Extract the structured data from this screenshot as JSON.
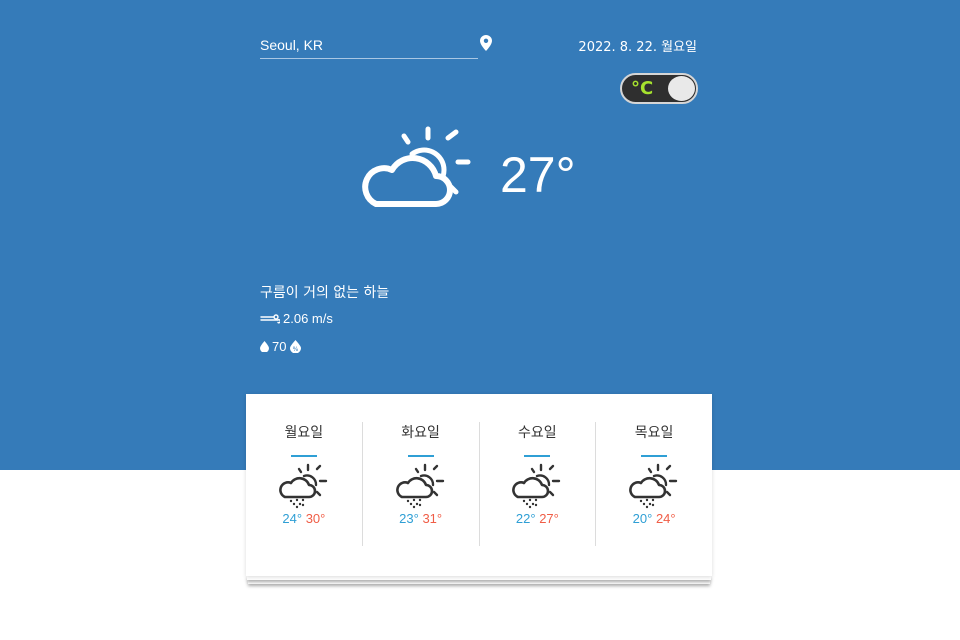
{
  "location": {
    "value": "Seoul, KR",
    "icon": "location-pin-icon"
  },
  "date": "2022. 8. 22. 월요일",
  "unit_toggle": {
    "label": "°C"
  },
  "current": {
    "temp": "27°",
    "icon": "partly-cloudy-icon",
    "description": "구름이 거의 없는 하늘",
    "wind": "2.06 m/s",
    "humidity": "70"
  },
  "forecast": [
    {
      "day": "월요일",
      "min": "24°",
      "max": "30°",
      "icon": "rain-sun-icon"
    },
    {
      "day": "화요일",
      "min": "23°",
      "max": "31°",
      "icon": "rain-sun-icon"
    },
    {
      "day": "수요일",
      "min": "22°",
      "max": "27°",
      "icon": "rain-sun-icon"
    },
    {
      "day": "목요일",
      "min": "20°",
      "max": "24°",
      "icon": "rain-sun-icon"
    }
  ],
  "colors": {
    "hero": "#357bb9",
    "min_temp": "#2f9fd5",
    "max_temp": "#f05d46",
    "toggle_text": "#a6e22e"
  }
}
